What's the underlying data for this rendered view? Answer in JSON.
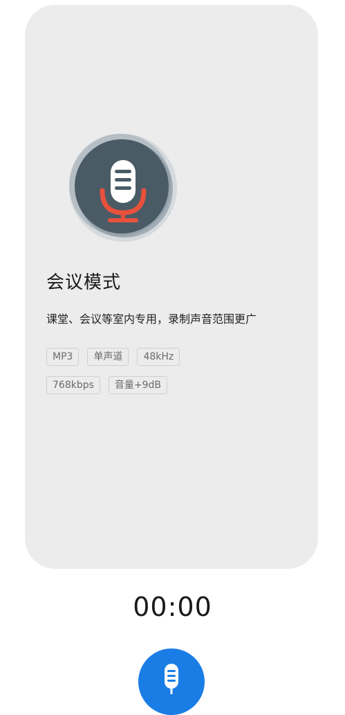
{
  "mode": {
    "icon": "microphone-icon",
    "title": "会议模式",
    "description": "课堂、会议等室内专用，录制声音范围更广",
    "tags_row1": [
      "MP3",
      "单声道",
      "48kHz"
    ],
    "tags_row2": [
      "768kbps",
      "音量+9dB"
    ]
  },
  "timer": {
    "value": "00:00"
  },
  "record_button": {
    "icon": "microphone-icon",
    "color": "#1a7de6"
  },
  "colors": {
    "card_background": "#ececec",
    "icon_circle": "#4a5b66",
    "mic_accent": "#e8513c"
  }
}
